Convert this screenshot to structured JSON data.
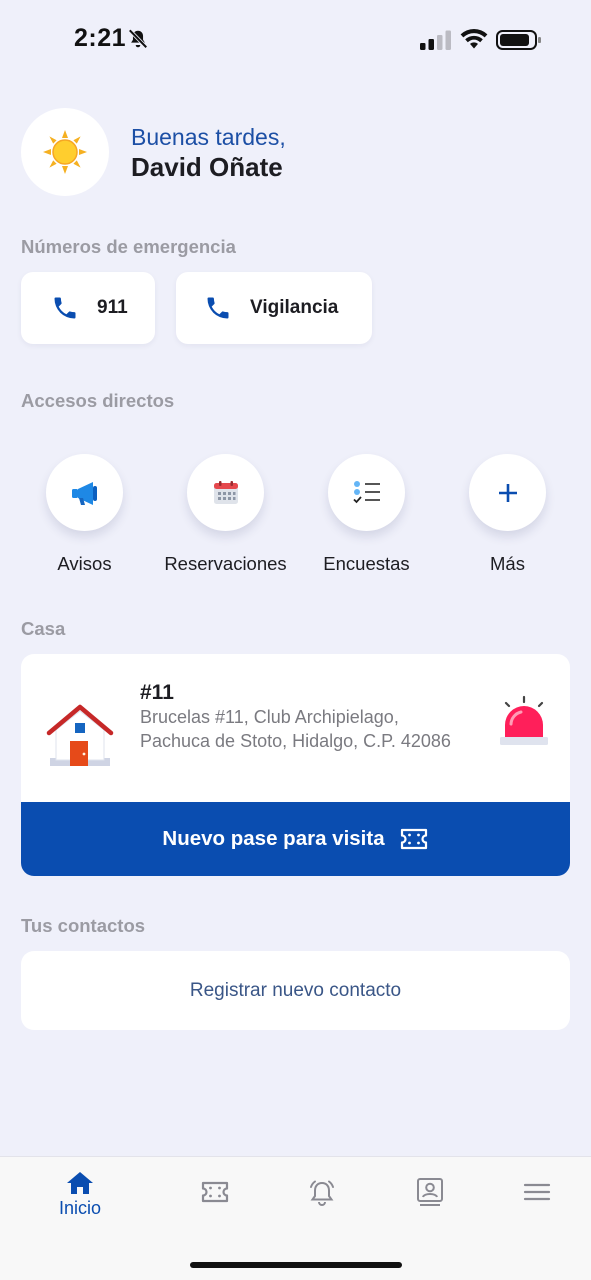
{
  "status_bar": {
    "time": "2:21"
  },
  "greeting": {
    "line1": "Buenas tardes,",
    "name": "David Oñate",
    "icon": "sun-icon"
  },
  "emergency": {
    "title": "Números de emergencia",
    "buttons": [
      {
        "label": "911",
        "icon": "phone-icon"
      },
      {
        "label": "Vigilancia",
        "icon": "phone-icon"
      }
    ]
  },
  "shortcuts": {
    "title": "Accesos directos",
    "items": [
      {
        "label": "Avisos",
        "icon": "megaphone-icon"
      },
      {
        "label": "Reservaciones",
        "icon": "calendar-icon"
      },
      {
        "label": "Encuestas",
        "icon": "checklist-icon"
      },
      {
        "label": "Más",
        "icon": "plus-icon"
      }
    ]
  },
  "casa": {
    "title": "Casa",
    "number": "#11",
    "address": "Brucelas #11, Club Archipielago, Pachuca de Stoto, Hidalgo, C.P. 42086",
    "visit_button": "Nuevo pase para visita"
  },
  "contacts": {
    "title": "Tus contactos",
    "register_label": "Registrar nuevo contacto"
  },
  "tabbar": {
    "items": [
      {
        "label": "Inicio",
        "icon": "home-icon",
        "active": true
      },
      {
        "icon": "ticket-icon"
      },
      {
        "icon": "bell-alarm-icon"
      },
      {
        "icon": "contact-card-icon"
      },
      {
        "icon": "menu-icon"
      }
    ]
  },
  "colors": {
    "accent": "#0a4db0",
    "background": "#eff0fa",
    "greeting": "#1c4fa5"
  }
}
